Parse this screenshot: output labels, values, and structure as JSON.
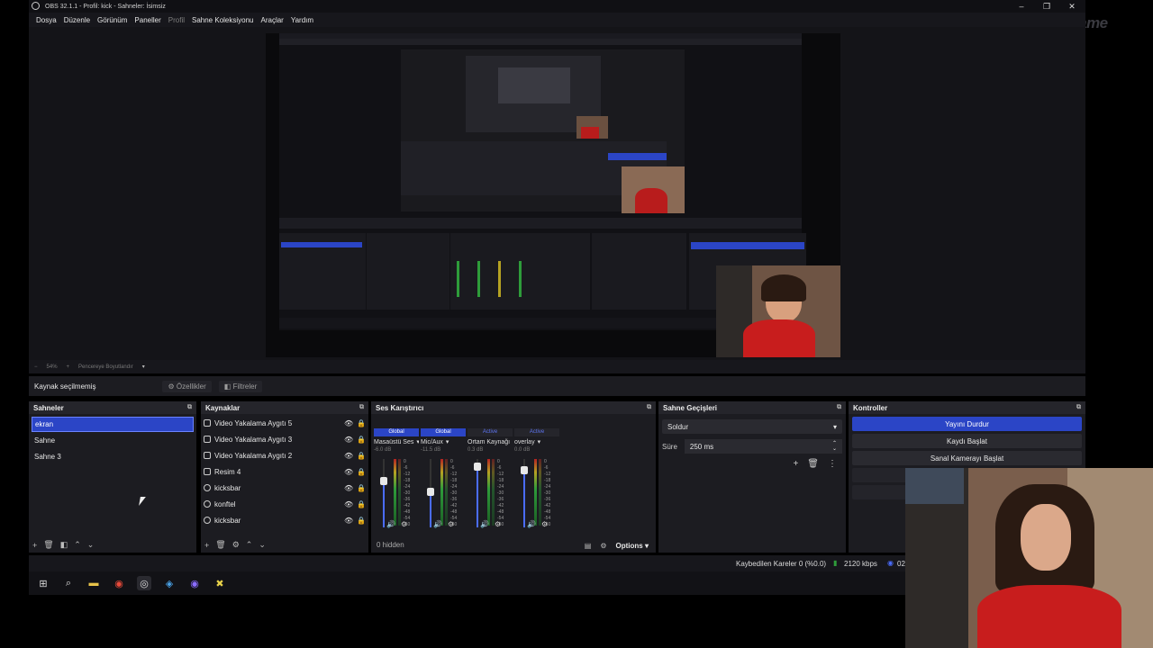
{
  "window": {
    "title": "OBS 32.1.1 - Profil: kick - Sahneler: İsimsiz"
  },
  "menu": [
    "Dosya",
    "Düzenle",
    "Görünüm",
    "Paneller",
    "Profil",
    "Sahne Koleksiyonu",
    "Araçlar",
    "Yardım"
  ],
  "watermark": "ByNoGame",
  "zoombar": {
    "zoom": "54%",
    "fit": "Pencereye Boyutlandır"
  },
  "context": {
    "no_source": "Kaynak seçilmemiş",
    "properties": "Özellikler",
    "filters": "Filtreler"
  },
  "scenes": {
    "title": "Sahneler",
    "items": [
      "ekran",
      "Sahne",
      "Sahne 3"
    ],
    "selected": 0
  },
  "sources": {
    "title": "Kaynaklar",
    "items": [
      {
        "name": "Video Yakalama Aygıtı 5",
        "icon": "camera-icon"
      },
      {
        "name": "Video Yakalama Aygıtı 3",
        "icon": "camera-icon"
      },
      {
        "name": "Video Yakalama Aygıtı 2",
        "icon": "camera-icon"
      },
      {
        "name": "Resim 4",
        "icon": "image-icon"
      },
      {
        "name": "kicksbar",
        "icon": "browser-icon"
      },
      {
        "name": "konftel",
        "icon": "browser-icon"
      },
      {
        "name": "kicksbar",
        "icon": "browser-icon"
      }
    ]
  },
  "mixer": {
    "title": "Ses Karıştırıcı",
    "channels": [
      {
        "tag": "Global",
        "name": "Masaüstü Ses",
        "db": "-6.0 dB",
        "active": false
      },
      {
        "tag": "Global",
        "name": "Mic/Aux",
        "db": "-11.5 dB",
        "active": false
      },
      {
        "tag": "Active",
        "name": "Ortam Kaynağı",
        "db": "0.3 dB",
        "active": true
      },
      {
        "tag": "Active",
        "name": "overlay",
        "db": "0.0 dB",
        "active": true
      }
    ],
    "scale": [
      "0",
      "-6",
      "-12",
      "-18",
      "-24",
      "-30",
      "-36",
      "-42",
      "-48",
      "-54",
      "-60"
    ],
    "hidden": "0 hidden",
    "options": "Options"
  },
  "transitions": {
    "title": "Sahne Geçişleri",
    "selected": "Soldur",
    "duration_label": "Süre",
    "duration": "250 ms"
  },
  "controls": {
    "title": "Kontroller",
    "buttons": [
      "Yayını Durdur",
      "Kaydı Başlat",
      "Sanal Kamerayı Başlat"
    ]
  },
  "status": {
    "dropped": "Kaybedilen Kareler 0 (%0.0)",
    "bitrate": "2120 kbps",
    "time": "02"
  },
  "colors": {
    "accent": "#2b45c6",
    "panel": "#1c1c21",
    "header": "#25252b"
  }
}
